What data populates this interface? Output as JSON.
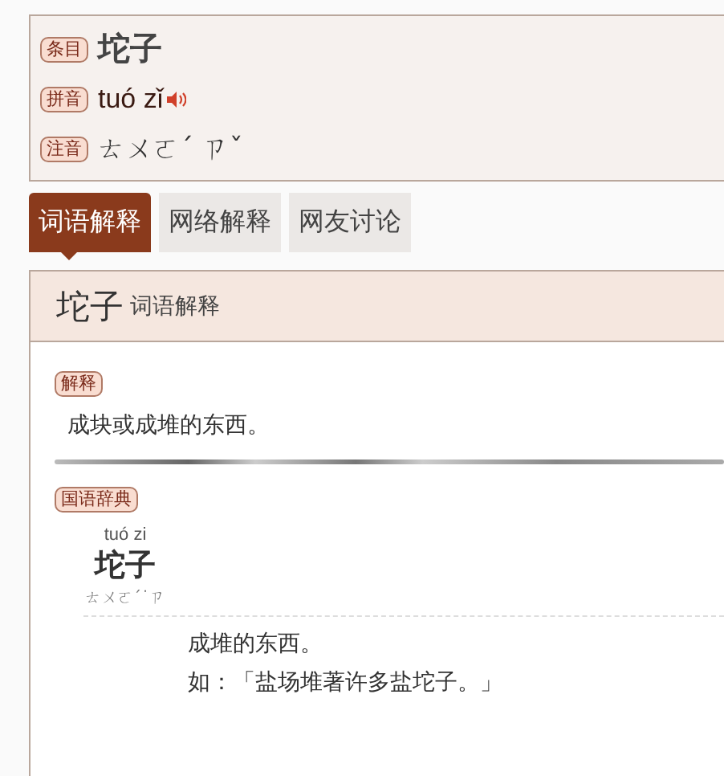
{
  "entry": {
    "rows": [
      {
        "label": "条目",
        "kind": "word",
        "value": "坨子"
      },
      {
        "label": "拼音",
        "kind": "pinyin",
        "value": "tuó zǐ"
      },
      {
        "label": "注音",
        "kind": "zhuyin",
        "value": "ㄊㄨㄛˊ ㄗˇ"
      }
    ]
  },
  "tabs": [
    {
      "label": "词语解释",
      "selected": true
    },
    {
      "label": "网络解释",
      "selected": false
    },
    {
      "label": "网友讨论",
      "selected": false
    }
  ],
  "panel": {
    "title": "坨子",
    "subtitle": "词语解释",
    "explanation": {
      "label": "解释",
      "text": "成块或成堆的东西。"
    },
    "dictionary": {
      "label": "国语辞典",
      "pinyin": "tuó zi",
      "word": "坨子",
      "zhuyin": "ㄊㄨㄛˊ˙ㄗ",
      "lines": [
        "成堆的东西。",
        "如：「盐场堆著许多盐坨子。」"
      ]
    }
  }
}
